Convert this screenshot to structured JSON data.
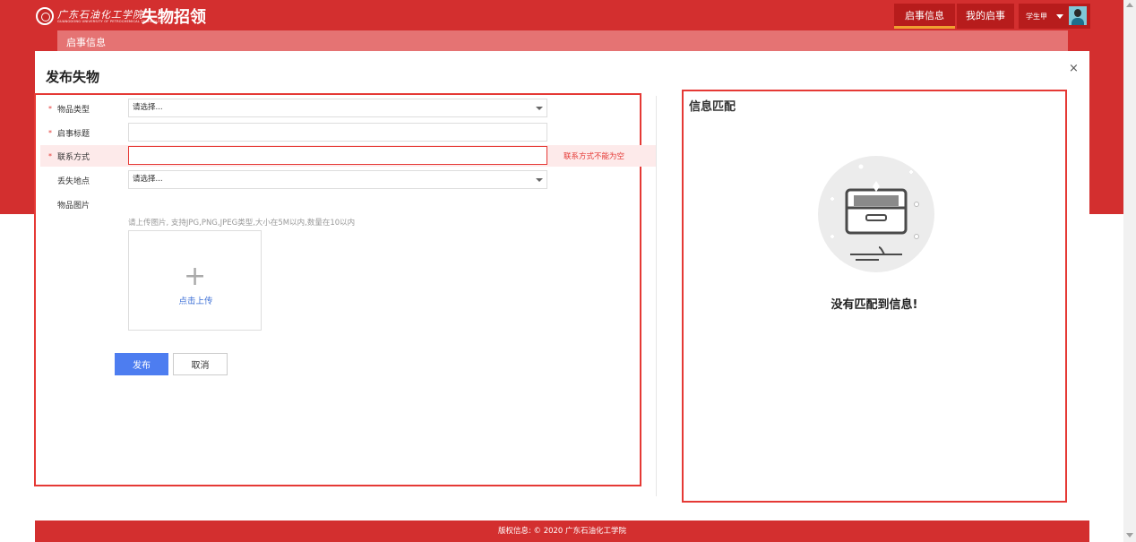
{
  "header": {
    "school_name_cn": "广东石油化工学院",
    "school_name_en": "GUANGDONG UNIVERSITY OF PETROCHEMICAL TECHNOLOGY",
    "app_title": "失物招领",
    "nav": [
      {
        "label": "启事信息",
        "active": true
      },
      {
        "label": "我的启事",
        "active": false
      }
    ],
    "user": {
      "name": "学生甲"
    }
  },
  "subnav": {
    "label": "启事信息"
  },
  "dialog": {
    "title": "发布失物",
    "close_icon": "×",
    "form": {
      "item_type": {
        "label": "物品类型",
        "required": true,
        "placeholder": "请选择..."
      },
      "notice_title": {
        "label": "启事标题",
        "required": true,
        "value": ""
      },
      "contact": {
        "label": "联系方式",
        "required": true,
        "value": "",
        "error": "联系方式不能为空"
      },
      "lost_place": {
        "label": "丢失地点",
        "required": false,
        "placeholder": "请选择..."
      },
      "images": {
        "label": "物品图片",
        "hint": "请上传图片, 支持JPG,PNG,JPEG类型,大小在5M以内,数量在10以内",
        "upload_label": "点击上传",
        "plus_icon": "+"
      },
      "publish_label": "发布",
      "cancel_label": "取消",
      "required_mark": "*"
    },
    "match": {
      "title": "信息匹配",
      "empty_text": "没有匹配到信息!"
    }
  },
  "footer": {
    "text": "版权信息: © 2020 广东石油化工学院"
  },
  "colors": {
    "brand_red": "#d32f2f",
    "accent_blue": "#4d7df0",
    "error_red": "#e53935"
  }
}
